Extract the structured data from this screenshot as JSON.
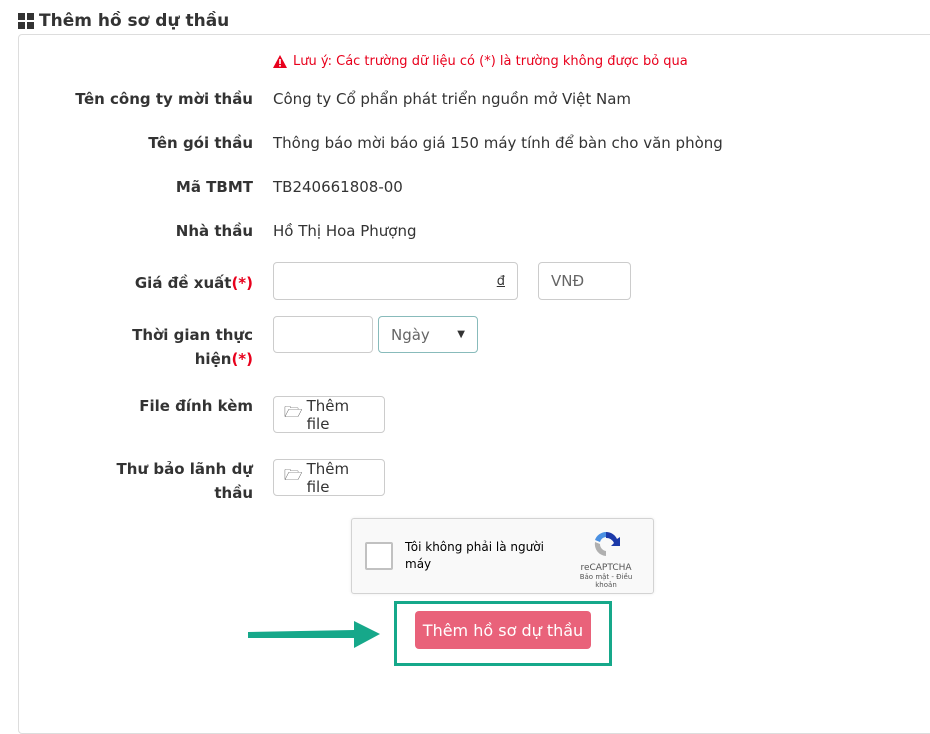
{
  "header": {
    "title": "Thêm hồ sơ dự thầu",
    "icon": "th-large-icon"
  },
  "note": "Lưu ý: Các trường dữ liệu có (*) là trường không được bỏ qua",
  "fields": {
    "company_label": "Tên công ty mời thầu",
    "company_value": "Công ty Cổ phẩn phát triển nguồn mở Việt Nam",
    "package_label": "Tên gói thầu",
    "package_value": "Thông báo mời báo giá 150 máy tính để bàn cho văn phòng",
    "code_label": "Mã TBMT",
    "code_value": "TB240661808-00",
    "contractor_label": "Nhà thầu",
    "contractor_value": "Hồ Thị Hoa Phượng",
    "price_label": "Giá đề xuất",
    "price_value": "",
    "price_suffix": "đ",
    "currency": "VNĐ",
    "time_label_1": "Thời gian thực",
    "time_label_2": "hiện",
    "time_value": "",
    "time_unit": "Ngày",
    "required_mark": "(*)",
    "file_label": "File đính kèm",
    "file_button": "Thêm file",
    "guarantee_label_1": "Thư bảo lãnh dự",
    "guarantee_label_2": "thầu",
    "guarantee_button": "Thêm file"
  },
  "captcha": {
    "text": "Tôi không phải là người máy",
    "brand": "reCAPTCHA",
    "links": "Bảo mật - Điều khoản"
  },
  "submit": "Thêm hồ sơ dự thầu",
  "colors": {
    "required": "#e8001c",
    "submit": "#e9627a",
    "highlight": "#16a88a"
  }
}
